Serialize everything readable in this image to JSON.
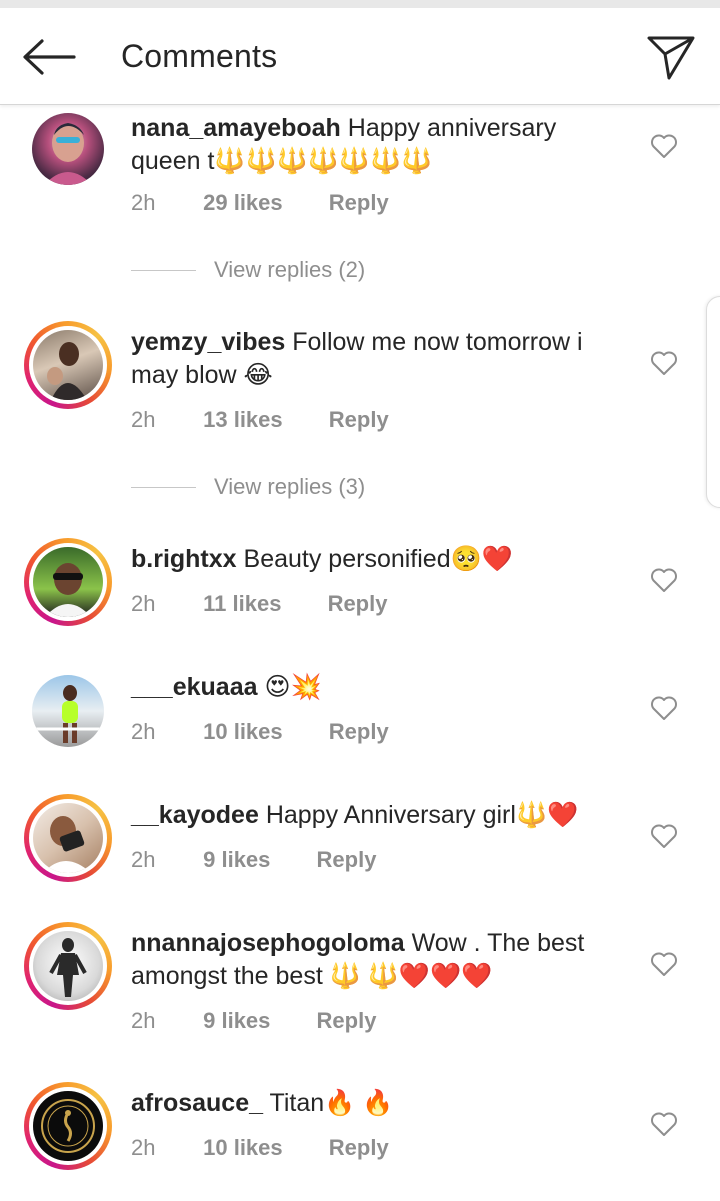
{
  "header": {
    "title": "Comments",
    "back_icon": "arrow-left-icon",
    "direct_icon": "paper-plane-icon"
  },
  "comments": [
    {
      "username": "nana_amayeboah",
      "text": "Happy anniversary queen t🔱🔱🔱🔱🔱🔱🔱",
      "time": "2h",
      "likes": "29 likes",
      "reply": "Reply",
      "view_replies": "View replies (2)"
    },
    {
      "username": "yemzy_vibes",
      "text": "Follow me now tomorrow i may blow 😂",
      "time": "2h",
      "likes": "13 likes",
      "reply": "Reply",
      "view_replies": "View replies (3)"
    },
    {
      "username": "b.rightxx",
      "text": "Beauty personified🥺❤️",
      "time": "2h",
      "likes": "11 likes",
      "reply": "Reply"
    },
    {
      "username": "___ekuaaa",
      "text": "😍💥",
      "time": "2h",
      "likes": "10 likes",
      "reply": "Reply"
    },
    {
      "username": "__kayodee",
      "text": "Happy Anniversary girl🔱❤️",
      "time": "2h",
      "likes": "9 likes",
      "reply": "Reply"
    },
    {
      "username": "nnannajosephogoloma",
      "text": "Wow . The best amongst the best 🔱 🔱❤️❤️❤️",
      "time": "2h",
      "likes": "9 likes",
      "reply": "Reply"
    },
    {
      "username": "afrosauce_",
      "text": "Titan🔥 🔥",
      "time": "2h",
      "likes": "10 likes",
      "reply": "Reply"
    }
  ],
  "colors": {
    "story_ring_start": "#c8168a",
    "story_ring_end": "#f6c244",
    "meta_gray": "#8e8e8e",
    "text": "#262626"
  }
}
